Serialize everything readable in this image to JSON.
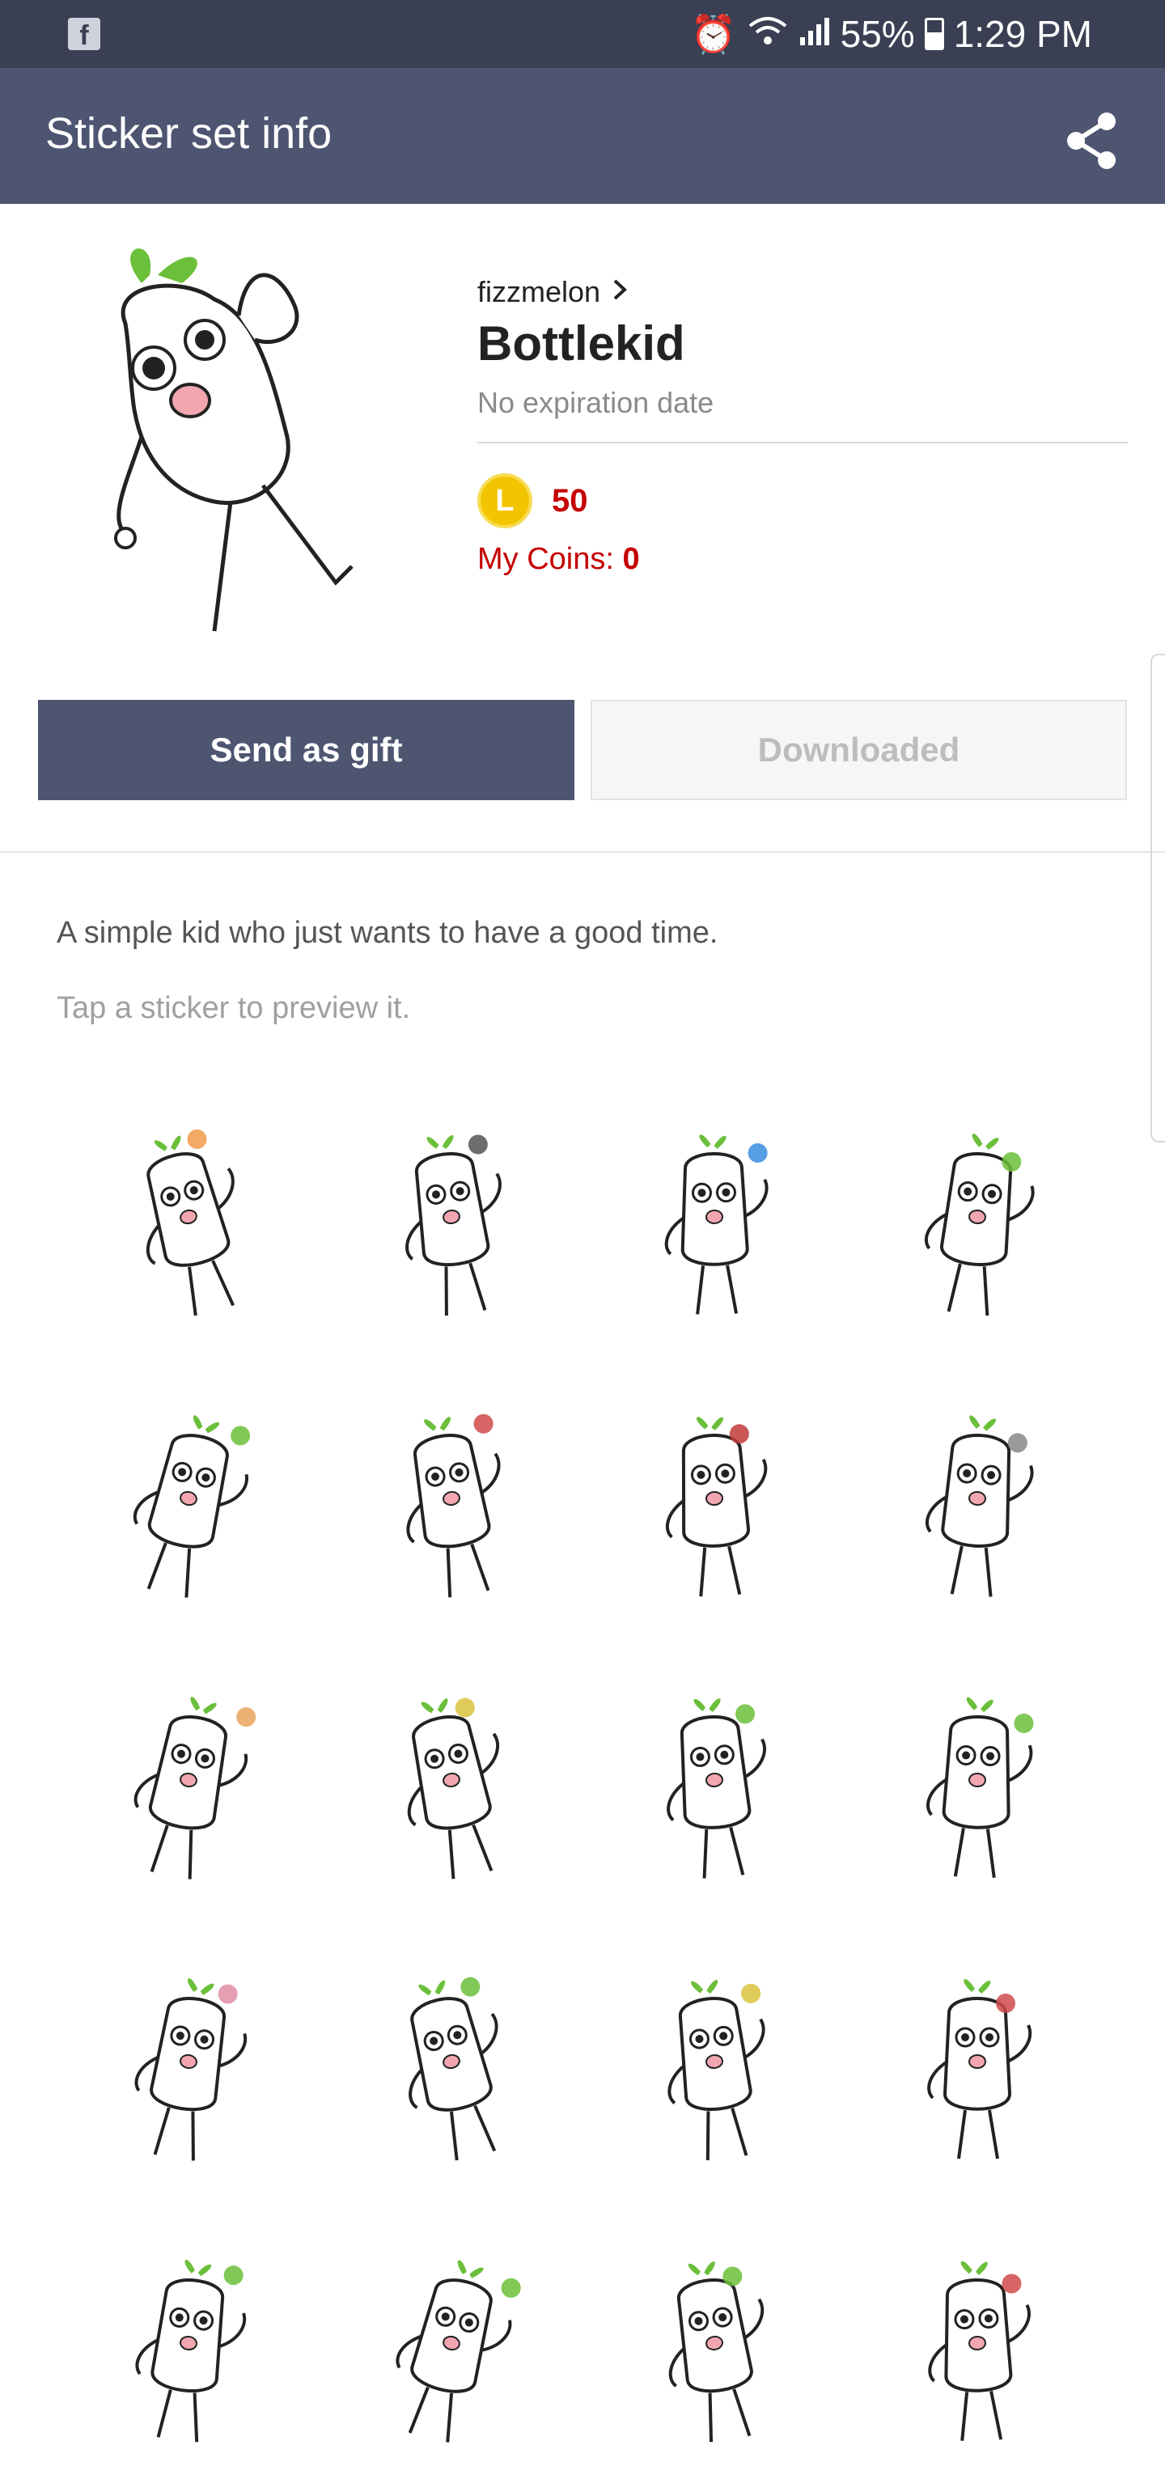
{
  "status_bar": {
    "battery": "55%",
    "time": "1:29 PM",
    "app_icon": "facebook-icon"
  },
  "app_bar": {
    "title": "Sticker set info",
    "share_icon": "share-icon"
  },
  "sticker_set": {
    "author": "fizzmelon",
    "title": "Bottlekid",
    "expiry": "No expiration date",
    "coin_letter": "L",
    "price": "50",
    "my_coins_label": "My Coins: ",
    "my_coins_value": "0"
  },
  "buttons": {
    "gift": "Send as gift",
    "download": "Downloaded"
  },
  "description": "A simple kid who just wants to have a good time.",
  "hint": "Tap a sticker to preview it.",
  "colors": {
    "status_bar": "#3a3f53",
    "app_bar": "#4d5571",
    "price": "#c40000",
    "coin": "#f3c400"
  },
  "stickers": [
    {
      "name": "sticker-1",
      "accent": "#f29a4a"
    },
    {
      "name": "sticker-2",
      "accent": "#555555"
    },
    {
      "name": "sticker-3",
      "accent": "#3a8ee0"
    },
    {
      "name": "sticker-4",
      "accent": "#6bbf3a"
    },
    {
      "name": "sticker-5",
      "accent": "#6bbf3a"
    },
    {
      "name": "sticker-6",
      "accent": "#d04a4a"
    },
    {
      "name": "sticker-7",
      "accent": "#c23a3a"
    },
    {
      "name": "sticker-8",
      "accent": "#888888"
    },
    {
      "name": "sticker-9",
      "accent": "#e8a35a"
    },
    {
      "name": "sticker-10",
      "accent": "#d9c23a"
    },
    {
      "name": "sticker-11",
      "accent": "#6bbf3a"
    },
    {
      "name": "sticker-12",
      "accent": "#6bbf3a"
    },
    {
      "name": "sticker-13",
      "accent": "#e08ea5"
    },
    {
      "name": "sticker-14",
      "accent": "#6bbf3a"
    },
    {
      "name": "sticker-15",
      "accent": "#d9c23a"
    },
    {
      "name": "sticker-16",
      "accent": "#d04a4a"
    },
    {
      "name": "sticker-17",
      "accent": "#6bbf3a"
    },
    {
      "name": "sticker-18",
      "accent": "#6bbf3a"
    },
    {
      "name": "sticker-19",
      "accent": "#6bbf3a"
    },
    {
      "name": "sticker-20",
      "accent": "#d04a4a"
    }
  ]
}
